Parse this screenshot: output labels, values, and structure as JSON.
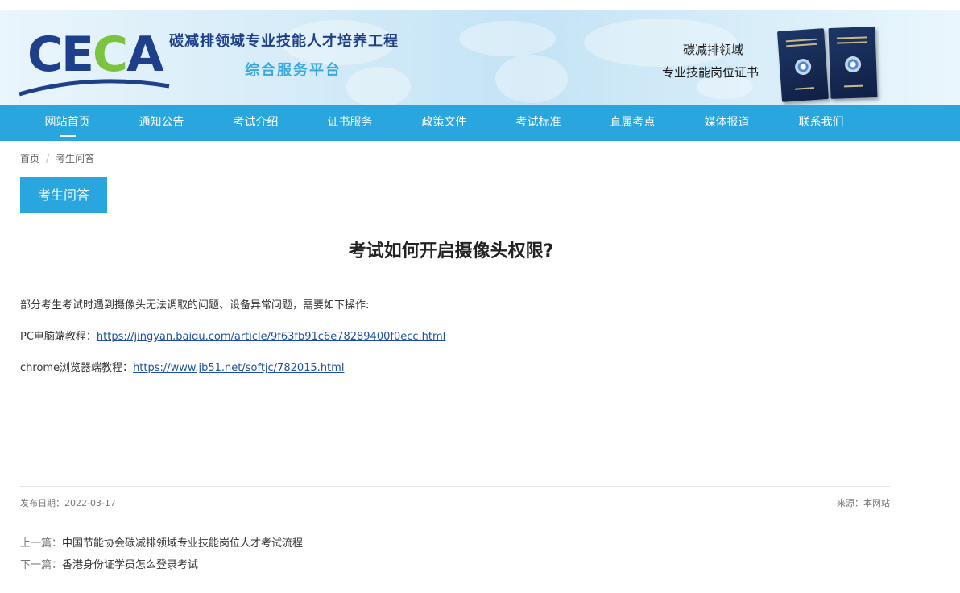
{
  "header": {
    "logo": "CECA",
    "site_title": "碳减排领域专业技能人才培养工程",
    "site_subtitle": "综合服务平台",
    "cert_title_line1": "碳减排领域",
    "cert_title_line2": "专业技能岗位证书"
  },
  "nav": {
    "items": [
      {
        "label": "网站首页",
        "active": true
      },
      {
        "label": "通知公告"
      },
      {
        "label": "考试介绍"
      },
      {
        "label": "证书服务"
      },
      {
        "label": "政策文件"
      },
      {
        "label": "考试标准"
      },
      {
        "label": "直属考点"
      },
      {
        "label": "媒体报道"
      },
      {
        "label": "联系我们"
      }
    ]
  },
  "breadcrumb": {
    "home": "首页",
    "separator": "/",
    "current": "考生问答"
  },
  "category_badge": "考生问答",
  "article": {
    "title": "考试如何开启摄像头权限?",
    "intro": "部分考生考试时遇到摄像头无法调取的问题、设备异常问题，需要如下操作:",
    "pc_label": "PC电脑端教程：",
    "pc_link": "https://jingyan.baidu.com/article/9f63fb91c6e78289400f0ecc.html",
    "chrome_label": "chrome浏览器端教程：",
    "chrome_link": "https://www.jb51.net/softjc/782015.html"
  },
  "meta": {
    "date": "发布日期：2022-03-17",
    "source": "来源：本网站"
  },
  "prev_next": {
    "prev_label": "上一篇：",
    "prev_title": "中国节能协会碳减排领域专业技能岗位人才考试流程",
    "next_label": "下一篇：",
    "next_title": "香港身份证学员怎么登录考试"
  },
  "colors": {
    "nav_bg": "#29a6de",
    "brand_blue": "#1e3f8a",
    "brand_green": "#7cc43f",
    "link": "#1e4f9e"
  }
}
